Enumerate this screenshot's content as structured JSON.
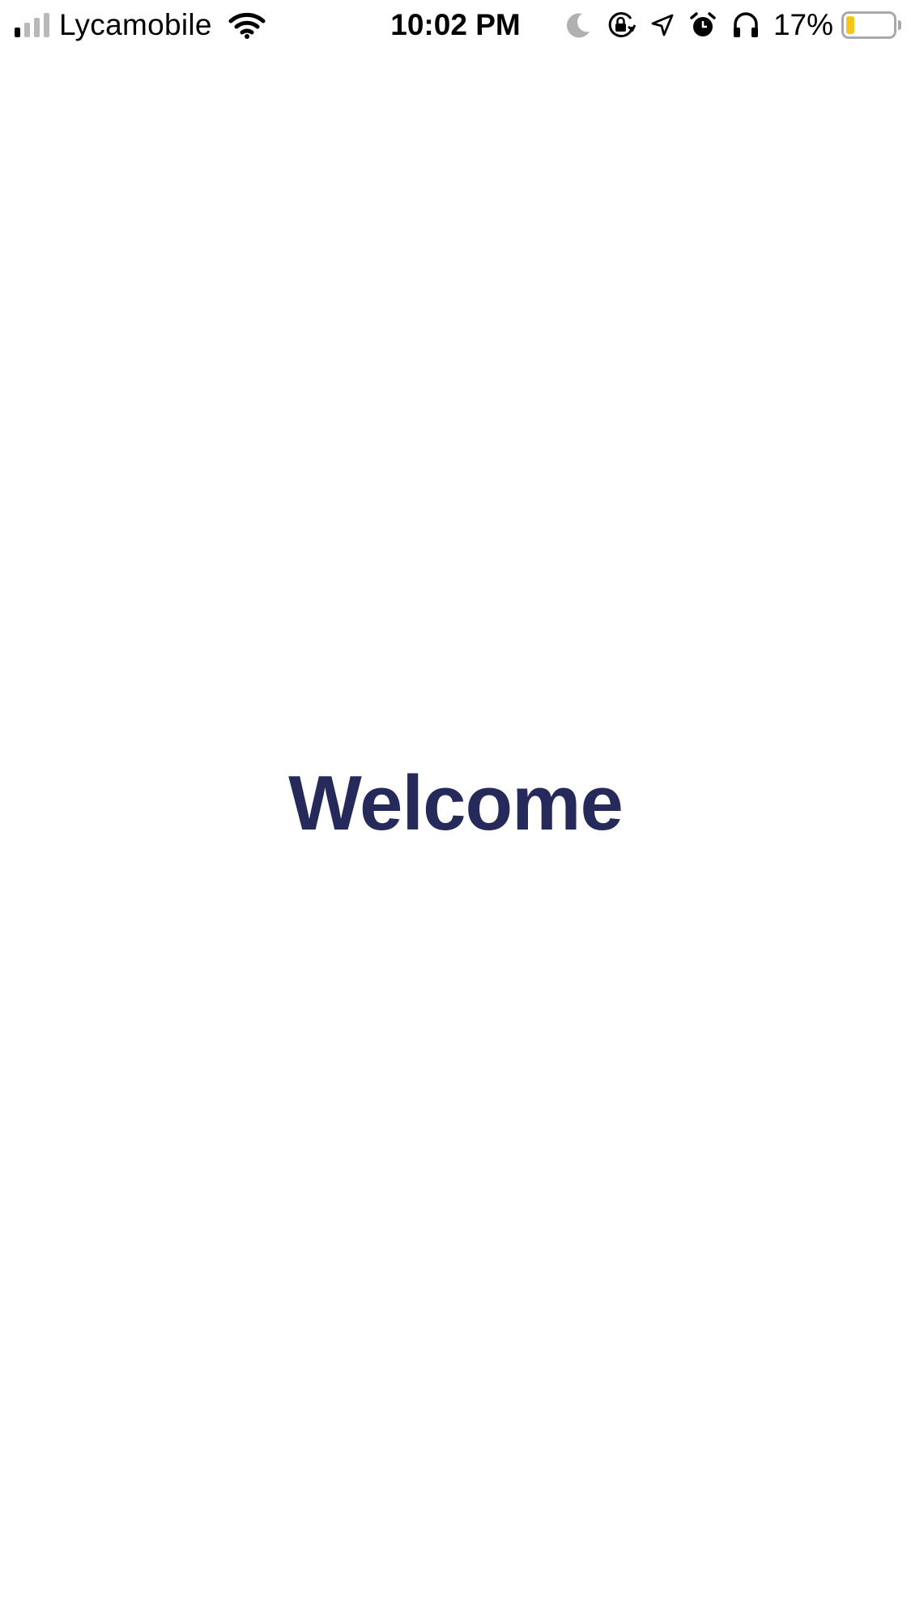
{
  "status_bar": {
    "carrier": "Lycamobile",
    "time": "10:02 PM",
    "battery_percent_label": "17%",
    "battery_level": 0.17,
    "signal_bars_total": 4,
    "signal_bars_filled": 1,
    "icons": [
      "signal-icon",
      "wifi-icon",
      "moon-icon",
      "orientation-lock-icon",
      "location-icon",
      "alarm-icon",
      "headphones-icon",
      "battery-icon"
    ]
  },
  "main": {
    "title": "Welcome"
  },
  "colors": {
    "title": "#262a5a",
    "background": "#ffffff",
    "battery_fill": "#f5c518",
    "inactive_gray": "#b8b8b8"
  }
}
